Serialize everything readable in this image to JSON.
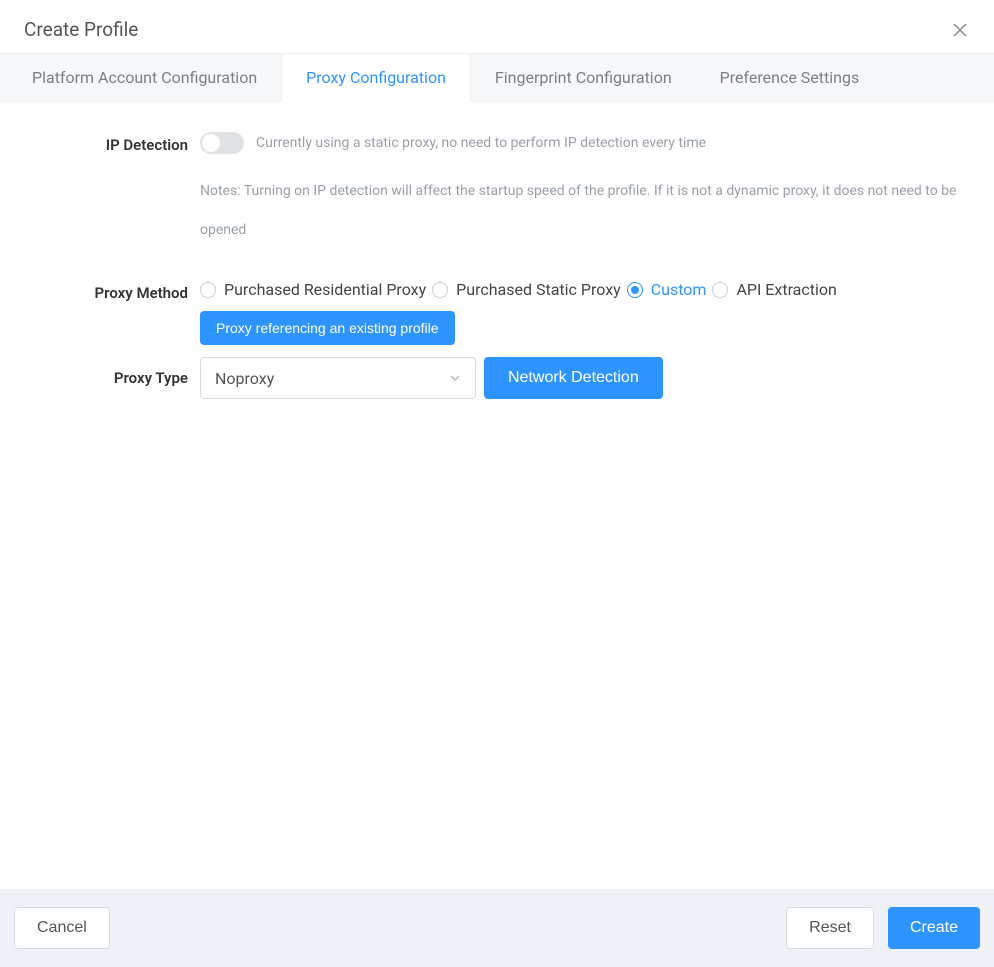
{
  "dialog": {
    "title": "Create Profile"
  },
  "tabs": {
    "platform": "Platform Account Configuration",
    "proxy": "Proxy Configuration",
    "fingerprint": "Fingerprint Configuration",
    "preference": "Preference Settings",
    "active": "proxy"
  },
  "ip_detection": {
    "label": "IP Detection",
    "enabled": false,
    "hint": "Currently using a static proxy, no need to perform IP detection every time",
    "notes": "Notes: Turning on IP detection will affect the startup speed of the profile. If it is not a dynamic proxy, it does not need to be opened"
  },
  "proxy_method": {
    "label": "Proxy Method",
    "options": {
      "residential": "Purchased Residential Proxy",
      "static": "Purchased Static Proxy",
      "custom": "Custom",
      "api": "API Extraction"
    },
    "selected": "custom",
    "ref_button": "Proxy referencing an existing profile"
  },
  "proxy_type": {
    "label": "Proxy Type",
    "value": "Noproxy",
    "detect_button": "Network Detection"
  },
  "footer": {
    "cancel": "Cancel",
    "reset": "Reset",
    "create": "Create"
  }
}
